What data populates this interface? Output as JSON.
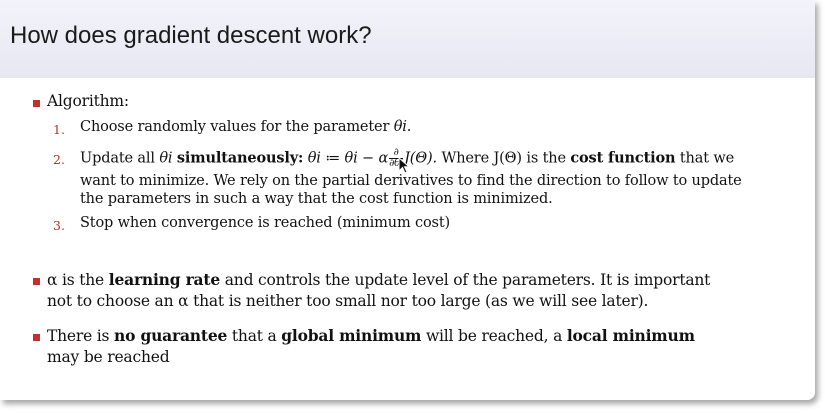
{
  "title": "How does gradient descent work?",
  "algorithm": {
    "heading": "Algorithm:",
    "steps": [
      {
        "number": "1.",
        "text": "Choose randomly values for the parameter ",
        "math": "θi",
        "end": "."
      },
      {
        "number": "2.",
        "line1_a": "Update all ",
        "line1_math_theta": "θi",
        "line1_bold": "simultaneously:",
        "line1_equation_left": "θi ≔ θi − α",
        "frac_top": "∂",
        "frac_bottom": "∂θi",
        "line1_equation_right": "J(Θ).",
        "line1_b": "Where J(Θ) is the ",
        "line1_bold2": "cost function",
        "line1_c": " that we",
        "line2": "want to minimize. We rely on the partial derivatives to find the direction to follow to update",
        "line3": "the parameters in such a way that the cost function is minimized."
      },
      {
        "number": "3.",
        "text": "Stop when convergence is reached (minimum cost)"
      }
    ]
  },
  "learning_rate": {
    "line1_a": "α is the ",
    "line1_bold": "learning rate",
    "line1_b": " and controls the update level of the parameters. It is important",
    "line2": "not to choose an α that is neither too small nor too large (as we will see later)."
  },
  "guarantee": {
    "line1_a": "There is ",
    "line1_bold1": "no guarantee",
    "line1_b": " that a ",
    "line1_bold2": "global minimum",
    "line1_c": " will be reached, a ",
    "line1_bold3": "local minimum",
    "line2": "may be reached"
  },
  "colors": {
    "bullet": "#c0322b",
    "header_bg": "#e9e9f4"
  }
}
